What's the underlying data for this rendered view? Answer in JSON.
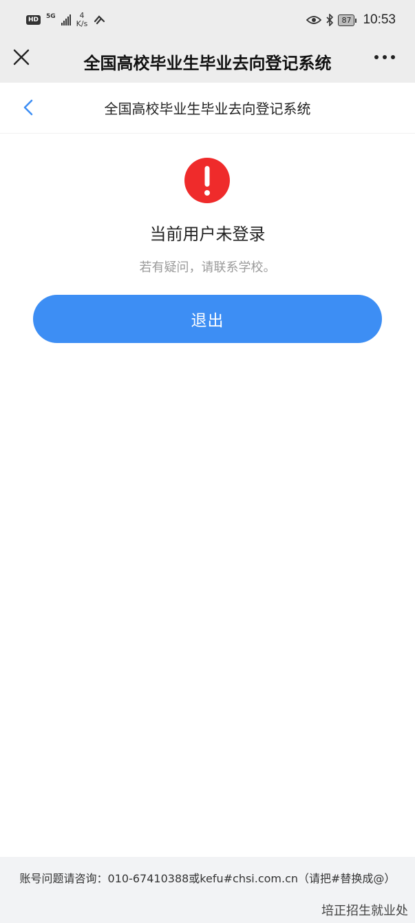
{
  "status_bar": {
    "hd_badge": "HD",
    "network": "5G",
    "net_speed_value": "4",
    "net_speed_unit": "K/s",
    "battery": "87",
    "time": "10:53",
    "icons": [
      "signal-icon",
      "link-icon",
      "eye-icon",
      "bluetooth-icon",
      "battery-icon"
    ]
  },
  "wechat_header": {
    "title": "全国高校毕业生毕业去向登记系统",
    "close_icon": "close-icon",
    "more_icon": "more-icon"
  },
  "page_nav": {
    "title": "全国高校毕业生毕业去向登记系统",
    "back_icon": "chevron-left-icon"
  },
  "message": {
    "icon": "alert-icon",
    "icon_color": "#ef2b2b",
    "title": "当前用户未登录",
    "subtitle": "若有疑问，请联系学校。"
  },
  "actions": {
    "logout_label": "退出",
    "button_color": "#3d8ef4"
  },
  "footer": {
    "contact": "账号问题请咨询：010-67410388或kefu#chsi.com.cn（请把#替换成@）",
    "org": "培正招生就业处"
  }
}
